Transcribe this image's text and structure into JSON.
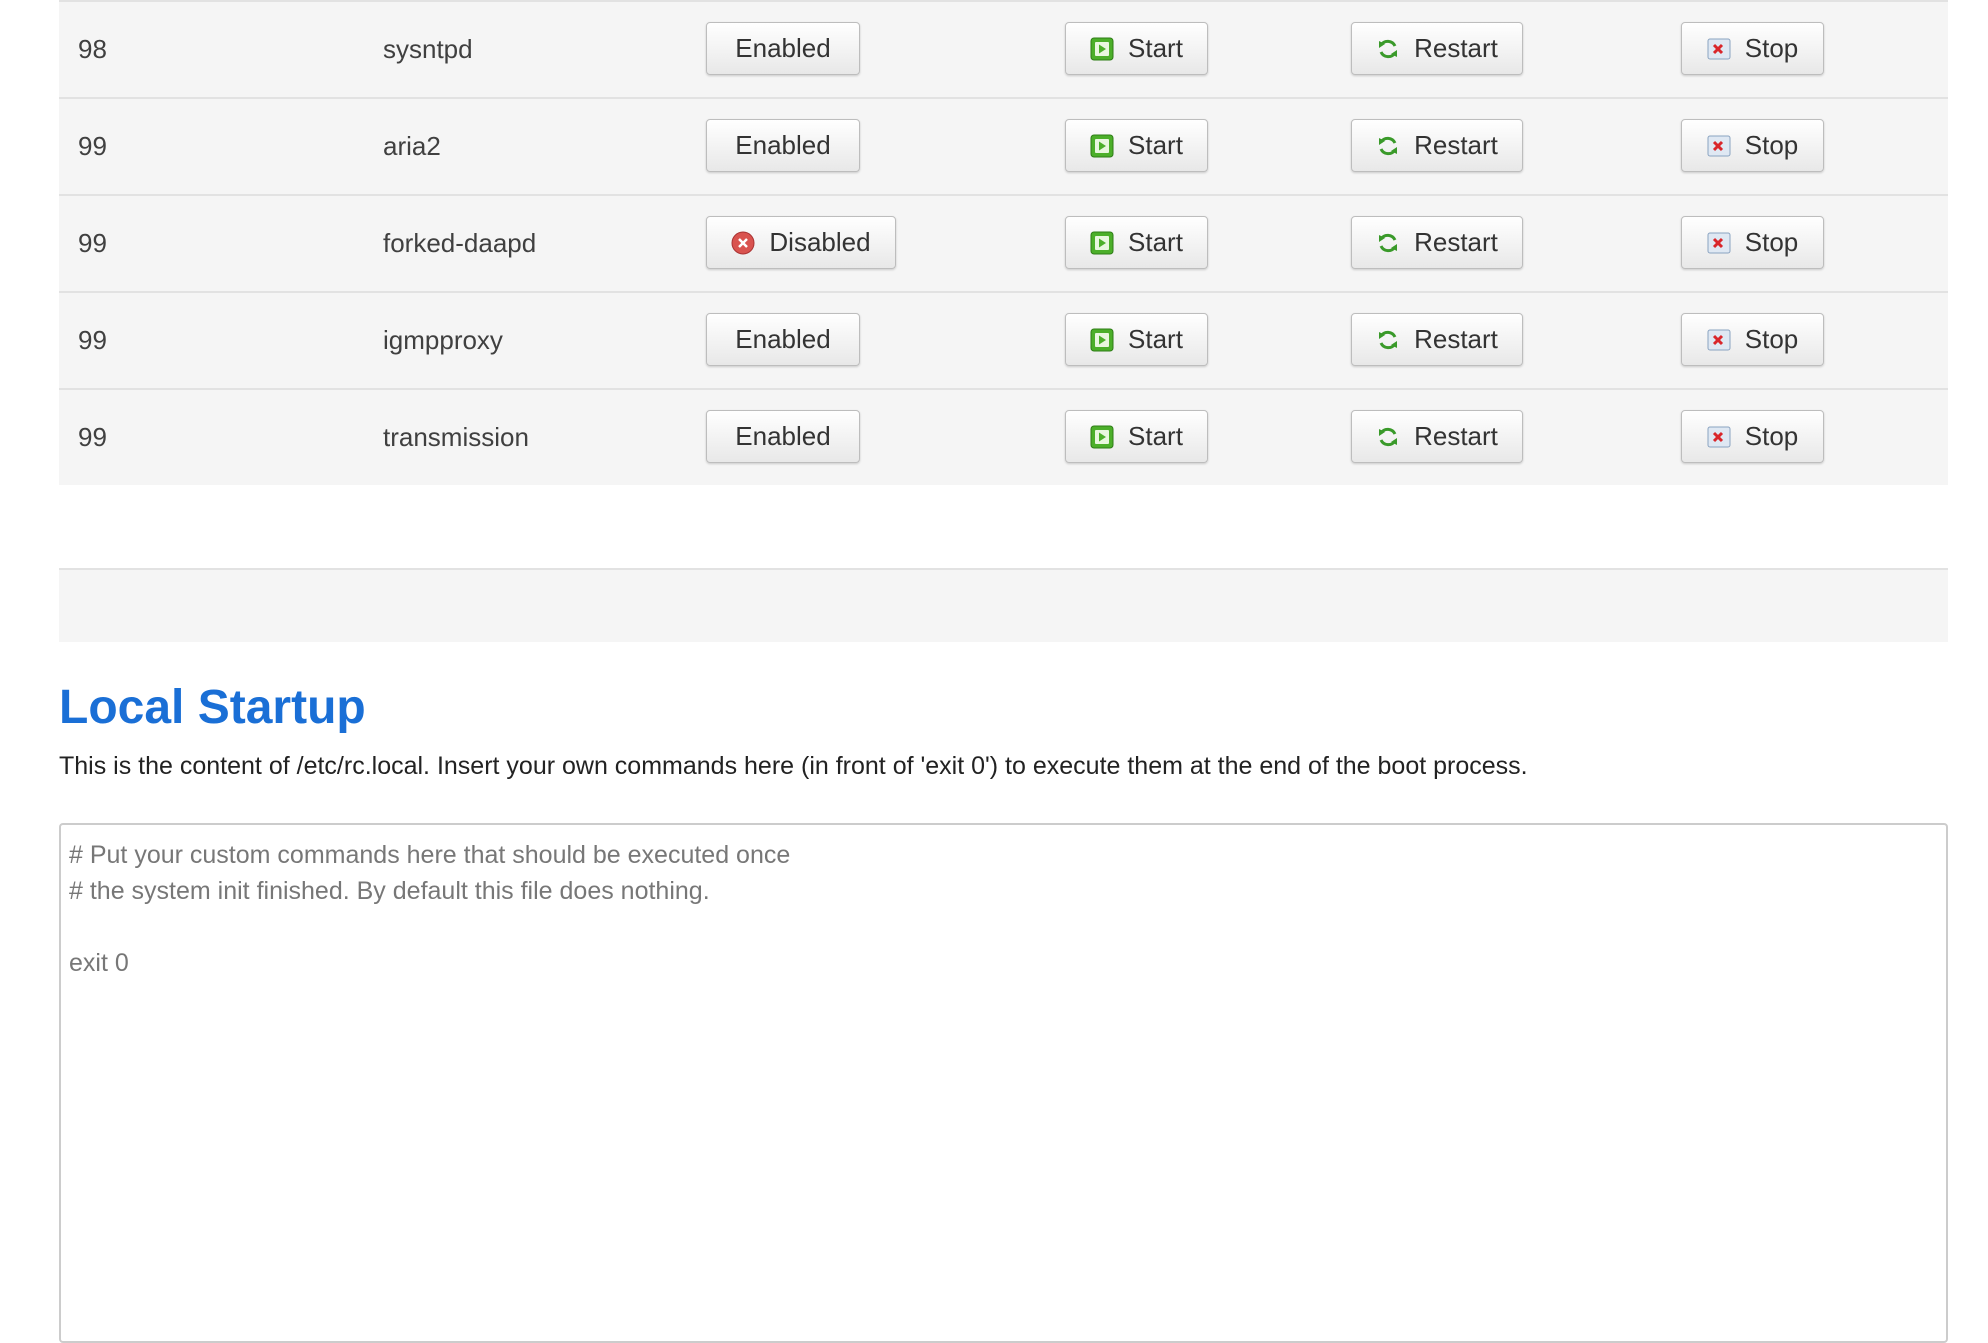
{
  "services": [
    {
      "priority": "98",
      "name": "sysntpd",
      "enable_label": "Enabled",
      "enabled": true,
      "start_label": "Start",
      "restart_label": "Restart",
      "stop_label": "Stop"
    },
    {
      "priority": "99",
      "name": "aria2",
      "enable_label": "Enabled",
      "enabled": true,
      "start_label": "Start",
      "restart_label": "Restart",
      "stop_label": "Stop"
    },
    {
      "priority": "99",
      "name": "forked-daapd",
      "enable_label": "Disabled",
      "enabled": false,
      "start_label": "Start",
      "restart_label": "Restart",
      "stop_label": "Stop"
    },
    {
      "priority": "99",
      "name": "igmpproxy",
      "enable_label": "Enabled",
      "enabled": true,
      "start_label": "Start",
      "restart_label": "Restart",
      "stop_label": "Stop"
    },
    {
      "priority": "99",
      "name": "transmission",
      "enable_label": "Enabled",
      "enabled": true,
      "start_label": "Start",
      "restart_label": "Restart",
      "stop_label": "Stop"
    }
  ],
  "icons": {
    "start": "play-icon",
    "restart": "reload-icon",
    "stop": "stop-icon",
    "disabled": "disabled-icon"
  },
  "colors": {
    "title": "#1a6fd6",
    "start_icon": "#4caf2a",
    "restart_icon": "#3a9a2a",
    "stop_icon": "#d9262b",
    "disabled_icon": "#d9534f"
  },
  "local_startup": {
    "title": "Local Startup",
    "description": "This is the content of /etc/rc.local. Insert your own commands here (in front of 'exit 0') to execute them at the end of the boot process.",
    "content": "# Put your custom commands here that should be executed once\n# the system init finished. By default this file does nothing.\n\nexit 0"
  }
}
